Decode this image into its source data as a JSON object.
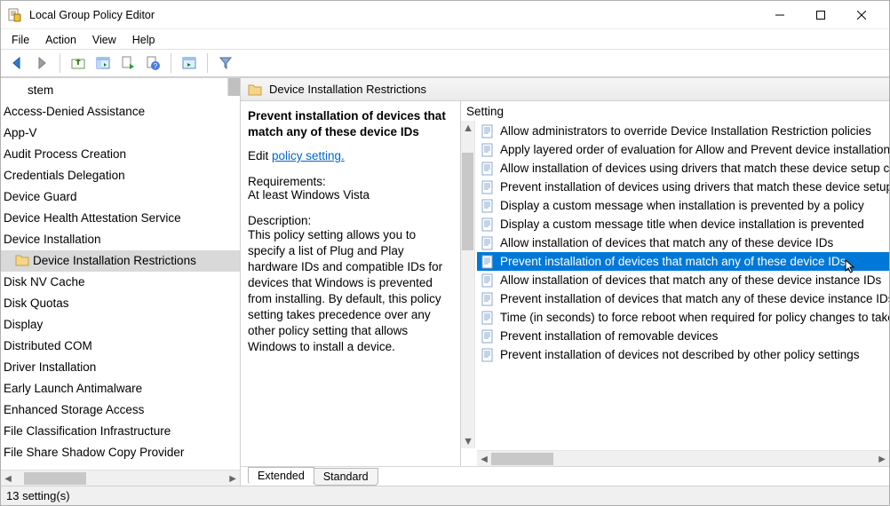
{
  "window": {
    "title": "Local Group Policy Editor"
  },
  "menus": {
    "file": "File",
    "action": "Action",
    "view": "View",
    "help": "Help"
  },
  "tree": {
    "top_fragment": "stem",
    "items": [
      "Access-Denied Assistance",
      "App-V",
      "Audit Process Creation",
      "Credentials Delegation",
      "Device Guard",
      "Device Health Attestation Service",
      "Device Installation",
      "Device Installation Restrictions",
      "Disk NV Cache",
      "Disk Quotas",
      "Display",
      "Distributed COM",
      "Driver Installation",
      "Early Launch Antimalware",
      "Enhanced Storage Access",
      "File Classification Infrastructure",
      "File Share Shadow Copy Provider"
    ],
    "selected_index": 7
  },
  "breadcrumb": {
    "label": "Device Installation Restrictions"
  },
  "description": {
    "title": "Prevent installation of devices that match any of these device IDs",
    "edit_prefix": "Edit ",
    "edit_link": "policy setting.",
    "requirements_label": "Requirements:",
    "requirements_text": "At least Windows Vista",
    "description_label": "Description:",
    "description_text": "This policy setting allows you to specify a list of Plug and Play hardware IDs and compatible IDs for devices that Windows is prevented from installing. By default, this policy setting takes precedence over any other policy setting that allows Windows to install a device."
  },
  "settings": {
    "header": "Setting",
    "items": [
      "Allow administrators to override Device Installation Restriction policies",
      "Apply layered order of evaluation for Allow and Prevent device installation",
      "Allow installation of devices using drivers that match these device setup classes",
      "Prevent installation of devices using drivers that match these device setup classes",
      "Display a custom message when installation is prevented by a policy",
      "Display a custom message title when device installation is prevented",
      "Allow installation of devices that match any of these device IDs",
      "Prevent installation of devices that match any of these device IDs",
      "Allow installation of devices that match any of these device instance IDs",
      "Prevent installation of devices that match any of these device instance IDs",
      "Time (in seconds) to force reboot when required for policy changes to take effect",
      "Prevent installation of removable devices",
      "Prevent installation of devices not described by other policy settings"
    ],
    "selected_index": 7
  },
  "tabs": {
    "extended": "Extended",
    "standard": "Standard"
  },
  "statusbar": {
    "text": "13 setting(s)"
  },
  "colors": {
    "selection": "#0078d7"
  }
}
